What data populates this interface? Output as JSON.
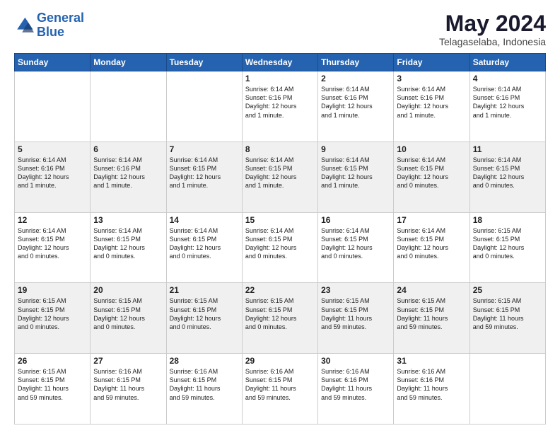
{
  "logo": {
    "line1": "General",
    "line2": "Blue"
  },
  "title": "May 2024",
  "subtitle": "Telagaselaba, Indonesia",
  "headers": [
    "Sunday",
    "Monday",
    "Tuesday",
    "Wednesday",
    "Thursday",
    "Friday",
    "Saturday"
  ],
  "weeks": [
    [
      {
        "day": "",
        "info": ""
      },
      {
        "day": "",
        "info": ""
      },
      {
        "day": "",
        "info": ""
      },
      {
        "day": "1",
        "info": "Sunrise: 6:14 AM\nSunset: 6:16 PM\nDaylight: 12 hours\nand 1 minute."
      },
      {
        "day": "2",
        "info": "Sunrise: 6:14 AM\nSunset: 6:16 PM\nDaylight: 12 hours\nand 1 minute."
      },
      {
        "day": "3",
        "info": "Sunrise: 6:14 AM\nSunset: 6:16 PM\nDaylight: 12 hours\nand 1 minute."
      },
      {
        "day": "4",
        "info": "Sunrise: 6:14 AM\nSunset: 6:16 PM\nDaylight: 12 hours\nand 1 minute."
      }
    ],
    [
      {
        "day": "5",
        "info": "Sunrise: 6:14 AM\nSunset: 6:16 PM\nDaylight: 12 hours\nand 1 minute."
      },
      {
        "day": "6",
        "info": "Sunrise: 6:14 AM\nSunset: 6:16 PM\nDaylight: 12 hours\nand 1 minute."
      },
      {
        "day": "7",
        "info": "Sunrise: 6:14 AM\nSunset: 6:15 PM\nDaylight: 12 hours\nand 1 minute."
      },
      {
        "day": "8",
        "info": "Sunrise: 6:14 AM\nSunset: 6:15 PM\nDaylight: 12 hours\nand 1 minute."
      },
      {
        "day": "9",
        "info": "Sunrise: 6:14 AM\nSunset: 6:15 PM\nDaylight: 12 hours\nand 1 minute."
      },
      {
        "day": "10",
        "info": "Sunrise: 6:14 AM\nSunset: 6:15 PM\nDaylight: 12 hours\nand 0 minutes."
      },
      {
        "day": "11",
        "info": "Sunrise: 6:14 AM\nSunset: 6:15 PM\nDaylight: 12 hours\nand 0 minutes."
      }
    ],
    [
      {
        "day": "12",
        "info": "Sunrise: 6:14 AM\nSunset: 6:15 PM\nDaylight: 12 hours\nand 0 minutes."
      },
      {
        "day": "13",
        "info": "Sunrise: 6:14 AM\nSunset: 6:15 PM\nDaylight: 12 hours\nand 0 minutes."
      },
      {
        "day": "14",
        "info": "Sunrise: 6:14 AM\nSunset: 6:15 PM\nDaylight: 12 hours\nand 0 minutes."
      },
      {
        "day": "15",
        "info": "Sunrise: 6:14 AM\nSunset: 6:15 PM\nDaylight: 12 hours\nand 0 minutes."
      },
      {
        "day": "16",
        "info": "Sunrise: 6:14 AM\nSunset: 6:15 PM\nDaylight: 12 hours\nand 0 minutes."
      },
      {
        "day": "17",
        "info": "Sunrise: 6:14 AM\nSunset: 6:15 PM\nDaylight: 12 hours\nand 0 minutes."
      },
      {
        "day": "18",
        "info": "Sunrise: 6:15 AM\nSunset: 6:15 PM\nDaylight: 12 hours\nand 0 minutes."
      }
    ],
    [
      {
        "day": "19",
        "info": "Sunrise: 6:15 AM\nSunset: 6:15 PM\nDaylight: 12 hours\nand 0 minutes."
      },
      {
        "day": "20",
        "info": "Sunrise: 6:15 AM\nSunset: 6:15 PM\nDaylight: 12 hours\nand 0 minutes."
      },
      {
        "day": "21",
        "info": "Sunrise: 6:15 AM\nSunset: 6:15 PM\nDaylight: 12 hours\nand 0 minutes."
      },
      {
        "day": "22",
        "info": "Sunrise: 6:15 AM\nSunset: 6:15 PM\nDaylight: 12 hours\nand 0 minutes."
      },
      {
        "day": "23",
        "info": "Sunrise: 6:15 AM\nSunset: 6:15 PM\nDaylight: 11 hours\nand 59 minutes."
      },
      {
        "day": "24",
        "info": "Sunrise: 6:15 AM\nSunset: 6:15 PM\nDaylight: 11 hours\nand 59 minutes."
      },
      {
        "day": "25",
        "info": "Sunrise: 6:15 AM\nSunset: 6:15 PM\nDaylight: 11 hours\nand 59 minutes."
      }
    ],
    [
      {
        "day": "26",
        "info": "Sunrise: 6:15 AM\nSunset: 6:15 PM\nDaylight: 11 hours\nand 59 minutes."
      },
      {
        "day": "27",
        "info": "Sunrise: 6:16 AM\nSunset: 6:15 PM\nDaylight: 11 hours\nand 59 minutes."
      },
      {
        "day": "28",
        "info": "Sunrise: 6:16 AM\nSunset: 6:15 PM\nDaylight: 11 hours\nand 59 minutes."
      },
      {
        "day": "29",
        "info": "Sunrise: 6:16 AM\nSunset: 6:15 PM\nDaylight: 11 hours\nand 59 minutes."
      },
      {
        "day": "30",
        "info": "Sunrise: 6:16 AM\nSunset: 6:16 PM\nDaylight: 11 hours\nand 59 minutes."
      },
      {
        "day": "31",
        "info": "Sunrise: 6:16 AM\nSunset: 6:16 PM\nDaylight: 11 hours\nand 59 minutes."
      },
      {
        "day": "",
        "info": ""
      }
    ]
  ]
}
